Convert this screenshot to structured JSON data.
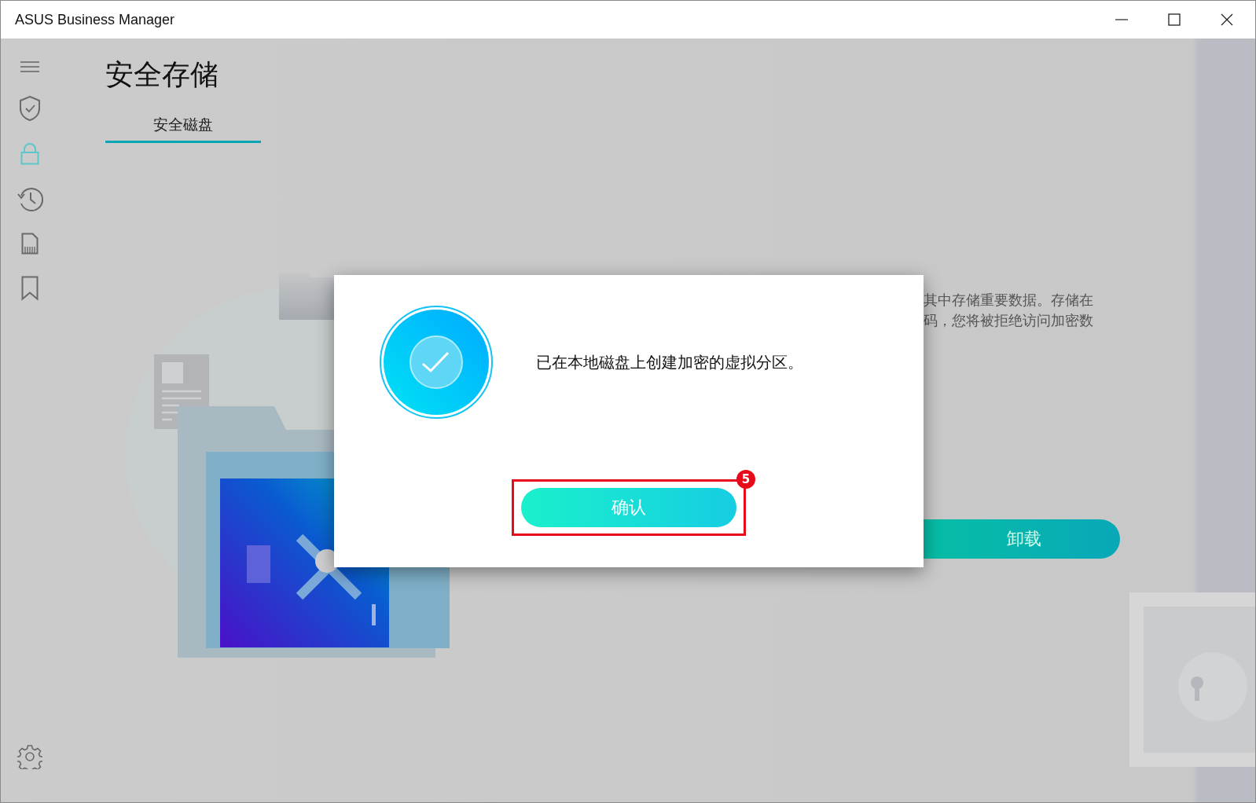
{
  "window": {
    "title": "ASUS Business Manager"
  },
  "sidebar": {
    "items": [
      {
        "kind": "shield",
        "selected": false
      },
      {
        "kind": "lock",
        "selected": true
      },
      {
        "kind": "history",
        "selected": false
      },
      {
        "kind": "sdcard",
        "selected": false
      },
      {
        "kind": "bookmark",
        "selected": false
      }
    ]
  },
  "page": {
    "title": "安全存储",
    "tabs": [
      {
        "label": "安全磁盘",
        "selected": true
      }
    ],
    "description_lines": [
      "其中存储重要数据。存储在",
      "码，您将被拒绝访问加密数"
    ],
    "uninstall_button": "卸载"
  },
  "dialog": {
    "message": "已在本地磁盘上创建加密的虚拟分区。",
    "confirm_button": "确认",
    "step_badge": "5"
  }
}
